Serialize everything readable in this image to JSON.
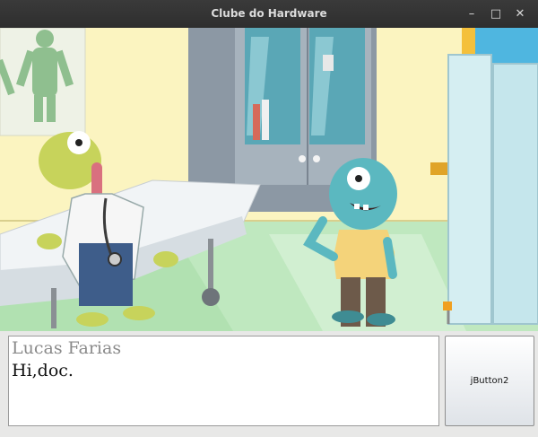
{
  "window": {
    "title": "Clube do Hardware",
    "minimize": "–",
    "maximize": "□",
    "close": "✕"
  },
  "scene": {
    "description_icon": "scene-image"
  },
  "dialog": {
    "speaker": "Lucas Farias",
    "text": "Hi,doc."
  },
  "button": {
    "label": "jButton2"
  },
  "colors": {
    "titlebar": "#2e2e2e",
    "wall": "#fbf4c0",
    "floor": "#b9e6b9",
    "zombie_skin": "#c7d35b",
    "patient_skin": "#5bb8c0"
  }
}
